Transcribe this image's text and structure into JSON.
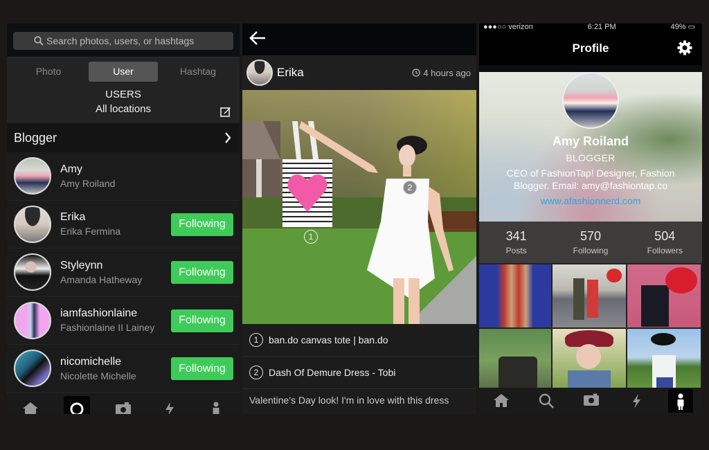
{
  "search_screen": {
    "search_placeholder": "Search photos, users, or hashtags",
    "segments": [
      {
        "label": "Photo",
        "active": false
      },
      {
        "label": "User",
        "active": true
      },
      {
        "label": "Hashtag",
        "active": false
      }
    ],
    "users_title": "USERS",
    "location": "All locations",
    "category": "Blogger",
    "users": [
      {
        "handle": "Amy",
        "name": "Amy Roiland",
        "button": null
      },
      {
        "handle": "Erika",
        "name": "Erika Fermina",
        "button": "Following"
      },
      {
        "handle": "Styleynn",
        "name": "Amanda Hatheway",
        "button": "Following"
      },
      {
        "handle": "iamfashionlaine",
        "name": "Fashionlaine II Lainey",
        "button": "Following"
      },
      {
        "handle": "nicomichelle",
        "name": "Nicolette Michelle",
        "button": "Following"
      }
    ],
    "tabbar": [
      "home-icon",
      "search-icon",
      "camera-icon",
      "lightning-icon",
      "person-icon"
    ],
    "active_tab": "search-icon"
  },
  "post_screen": {
    "user": "Erika",
    "time": "4 hours ago",
    "tags": [
      {
        "num": "1",
        "label": "ban.do canvas tote | ban.do"
      },
      {
        "num": "2",
        "label": "Dash Of Demure Dress - Tobi"
      }
    ],
    "caption": "Valentine's Day look! I'm in love with this dress"
  },
  "profile_screen": {
    "status": {
      "carrier": "verizon",
      "time": "6:21 PM",
      "battery": "49%"
    },
    "title": "Profile",
    "name": "Amy Roiland",
    "role": "BLOGGER",
    "bio": "CEO of FashionTap! Designer, Fashion Blogger. Email: amy@fashiontap.co",
    "website": "www.afashionnerd.com",
    "stats": [
      {
        "value": "341",
        "label": "Posts"
      },
      {
        "value": "570",
        "label": "Following"
      },
      {
        "value": "504",
        "label": "Followers"
      }
    ],
    "tabbar": [
      "home-icon",
      "search-icon",
      "camera-icon",
      "lightning-icon",
      "person-icon"
    ],
    "active_tab": "person-icon"
  },
  "colors": {
    "follow_green": "#3fcb59",
    "link_blue": "#2ca6e6",
    "background": "#1a1918"
  }
}
